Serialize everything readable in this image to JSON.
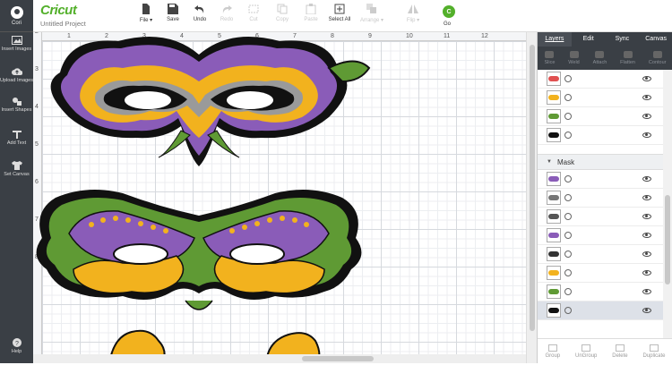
{
  "sidebar": {
    "user_name": "Cori",
    "items": [
      {
        "label": "Insert Images",
        "icon": "image-icon"
      },
      {
        "label": "Upload Images",
        "icon": "upload-cloud-icon"
      },
      {
        "label": "Insert Shapes",
        "icon": "shapes-icon"
      },
      {
        "label": "Add Text",
        "icon": "text-icon"
      },
      {
        "label": "Set Canvas",
        "icon": "shirt-icon"
      },
      {
        "label": "Help",
        "icon": "help-icon"
      }
    ]
  },
  "header": {
    "logo": "Cricut",
    "project_name": "Untitled Project",
    "tools": [
      {
        "label": "File",
        "icon": "file-icon",
        "enabled": true
      },
      {
        "label": "Save",
        "icon": "save-icon",
        "enabled": true
      },
      {
        "label": "Undo",
        "icon": "undo-icon",
        "enabled": true
      },
      {
        "label": "Redo",
        "icon": "redo-icon",
        "enabled": false
      },
      {
        "label": "Cut",
        "icon": "cut-icon",
        "enabled": false
      },
      {
        "label": "Copy",
        "icon": "copy-icon",
        "enabled": false
      },
      {
        "label": "Paste",
        "icon": "paste-icon",
        "enabled": false
      },
      {
        "label": "Select All",
        "icon": "select-all-icon",
        "enabled": true
      },
      {
        "label": "Arrange",
        "icon": "arrange-icon",
        "enabled": false
      },
      {
        "label": "Flip",
        "icon": "flip-icon",
        "enabled": false
      }
    ],
    "go_label": "Go",
    "go_icon_letter": "C"
  },
  "canvas": {
    "ruler_top": [
      "1",
      "2",
      "3",
      "4",
      "5",
      "6",
      "7",
      "8",
      "9",
      "10",
      "11",
      "12"
    ],
    "ruler_left": [
      "2",
      "3",
      "4",
      "5",
      "6",
      "7",
      "8"
    ]
  },
  "panel": {
    "tabs": [
      "Layers",
      "Edit",
      "Sync",
      "Canvas"
    ],
    "tools": [
      "Slice",
      "Weld",
      "Attach",
      "Flatten",
      "Contour"
    ],
    "layers_top": [
      {
        "thumb_color": "#e05050"
      },
      {
        "thumb_color": "#f2b21e"
      },
      {
        "thumb_color": "#5f9a34"
      },
      {
        "thumb_color": "#111111"
      }
    ],
    "group_name": "Mask",
    "layers_group": [
      {
        "thumb_color": "#8a5cb8"
      },
      {
        "thumb_color": "#777777"
      },
      {
        "thumb_color": "#555555"
      },
      {
        "thumb_color": "#8a5cb8"
      },
      {
        "thumb_color": "#333333"
      },
      {
        "thumb_color": "#f2b21e"
      },
      {
        "thumb_color": "#5f9a34"
      },
      {
        "thumb_color": "#111111"
      }
    ],
    "bottom_buttons": [
      "Group",
      "UnGroup",
      "Delete",
      "Duplicate"
    ]
  },
  "colors": {
    "brand_green": "#53b02b",
    "sidebar_bg": "#3a3f45",
    "mask_purple": "#8a5cb8",
    "mask_yellow": "#f2b21e",
    "mask_green": "#5f9a34",
    "mask_gray": "#9a9a9a"
  }
}
